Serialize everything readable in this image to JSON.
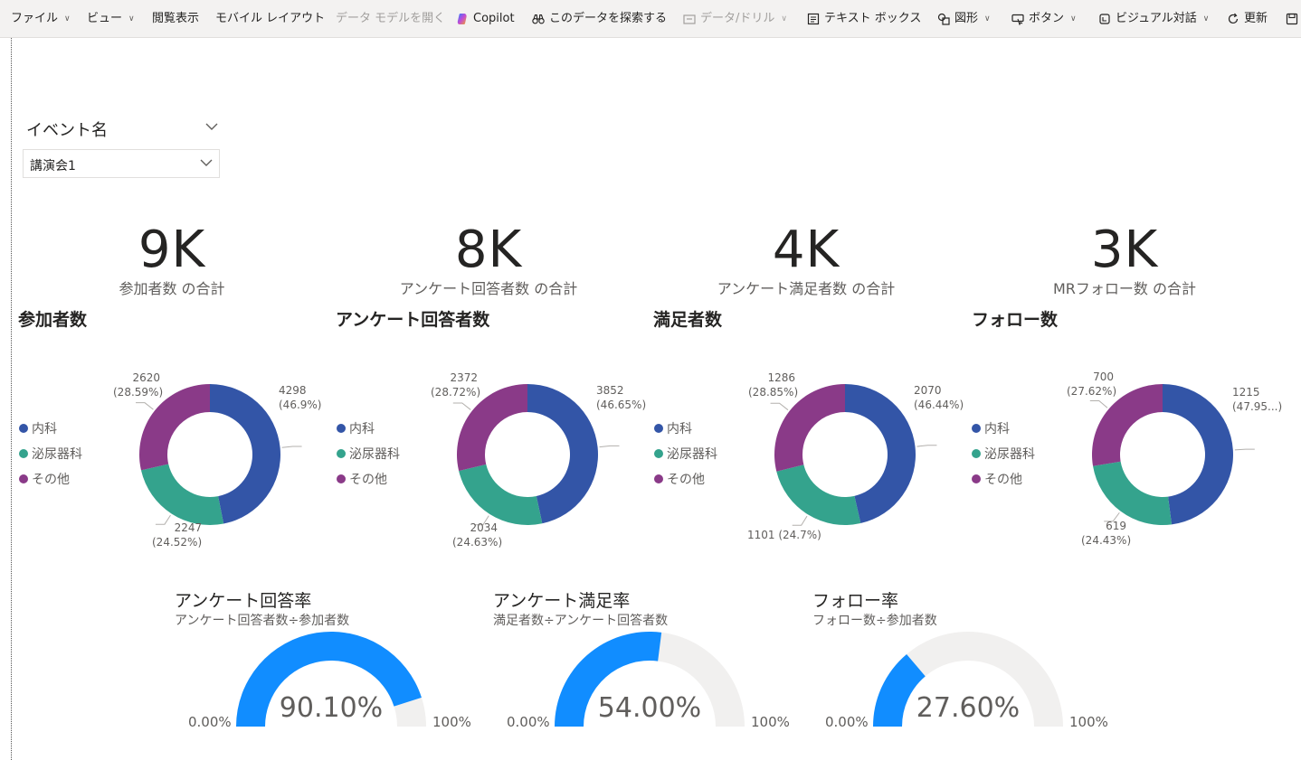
{
  "toolbar": {
    "items": [
      {
        "label": "ファイル",
        "chevron": true
      },
      {
        "label": "ビュー",
        "chevron": true
      },
      {
        "label": "閲覧表示",
        "chevron": false
      },
      {
        "label": "モバイル レイアウト",
        "chevron": false
      },
      {
        "label": "データ モデルを開く",
        "chevron": false,
        "disabled": true
      },
      {
        "label": "Copilot",
        "chevron": false,
        "icon": "copilot-icon"
      },
      {
        "label": "このデータを探索する",
        "chevron": false,
        "icon": "binoculars-icon"
      },
      {
        "label": "データ/ドリル",
        "chevron": true,
        "icon": "drill-icon",
        "disabled": true
      },
      {
        "label": "テキスト ボックス",
        "chevron": false,
        "icon": "textbox-icon"
      },
      {
        "label": "図形",
        "chevron": true,
        "icon": "shapes-icon"
      },
      {
        "label": "ボタン",
        "chevron": true,
        "icon": "button-icon"
      },
      {
        "label": "ビジュアル対話",
        "chevron": true,
        "icon": "visual-interaction-icon"
      },
      {
        "label": "更新",
        "chevron": false,
        "icon": "refresh-icon"
      }
    ]
  },
  "slicer": {
    "title": "イベント名",
    "value": "講演会1"
  },
  "kpis": [
    {
      "value": "9K",
      "label": "参加者数 の合計"
    },
    {
      "value": "8K",
      "label": "アンケート回答者数 の合計"
    },
    {
      "value": "4K",
      "label": "アンケート満足者数 の合計"
    },
    {
      "value": "3K",
      "label": "MRフォロー数 の合計"
    }
  ],
  "legend": [
    {
      "label": "内科",
      "color": "#3355a7"
    },
    {
      "label": "泌尿器科",
      "color": "#34a38d"
    },
    {
      "label": "その他",
      "color": "#8a3a88"
    }
  ],
  "chart_data": [
    {
      "type": "pie",
      "variant": "donut",
      "title": "参加者数",
      "categories": [
        "内科",
        "泌尿器科",
        "その他"
      ],
      "values": [
        4298,
        2247,
        2620
      ],
      "labels": [
        [
          "4298",
          "(46.9%)"
        ],
        [
          "2247",
          "(24.52%)"
        ],
        [
          "2620",
          "(28.59%)"
        ]
      ]
    },
    {
      "type": "pie",
      "variant": "donut",
      "title": "アンケート回答者数",
      "categories": [
        "内科",
        "泌尿器科",
        "その他"
      ],
      "values": [
        3852,
        2034,
        2372
      ],
      "labels": [
        [
          "3852",
          "(46.65%)"
        ],
        [
          "2034",
          "(24.63%)"
        ],
        [
          "2372",
          "(28.72%)"
        ]
      ]
    },
    {
      "type": "pie",
      "variant": "donut",
      "title": "満足者数",
      "categories": [
        "内科",
        "泌尿器科",
        "その他"
      ],
      "values": [
        2070,
        1101,
        1286
      ],
      "labels": [
        [
          "2070",
          "(46.44%)"
        ],
        [
          "1101 (24.7%)"
        ],
        [
          "1286",
          "(28.85%)"
        ]
      ]
    },
    {
      "type": "pie",
      "variant": "donut",
      "title": "フォロー数",
      "categories": [
        "内科",
        "泌尿器科",
        "その他"
      ],
      "values": [
        1215,
        619,
        700
      ],
      "labels": [
        [
          "1215",
          "(47.95...)"
        ],
        [
          "619",
          "(24.43%)"
        ],
        [
          "700",
          "(27.62%)"
        ]
      ]
    },
    {
      "type": "gauge",
      "title": "アンケート回答率",
      "subtitle": "アンケート回答者数÷参加者数",
      "value": 90.1,
      "value_label": "90.10%",
      "min_label": "0.00%",
      "max_label": "100%"
    },
    {
      "type": "gauge",
      "title": "アンケート満足率",
      "subtitle": "満足者数÷アンケート回答者数",
      "value": 54.0,
      "value_label": "54.00%",
      "min_label": "0.00%",
      "max_label": "100%"
    },
    {
      "type": "gauge",
      "title": "フォロー率",
      "subtitle": "フォロー数÷参加者数",
      "value": 27.6,
      "value_label": "27.60%",
      "min_label": "0.00%",
      "max_label": "100%"
    }
  ],
  "colors": {
    "gauge_fill": "#118dff",
    "gauge_track": "#f1f0ef"
  }
}
